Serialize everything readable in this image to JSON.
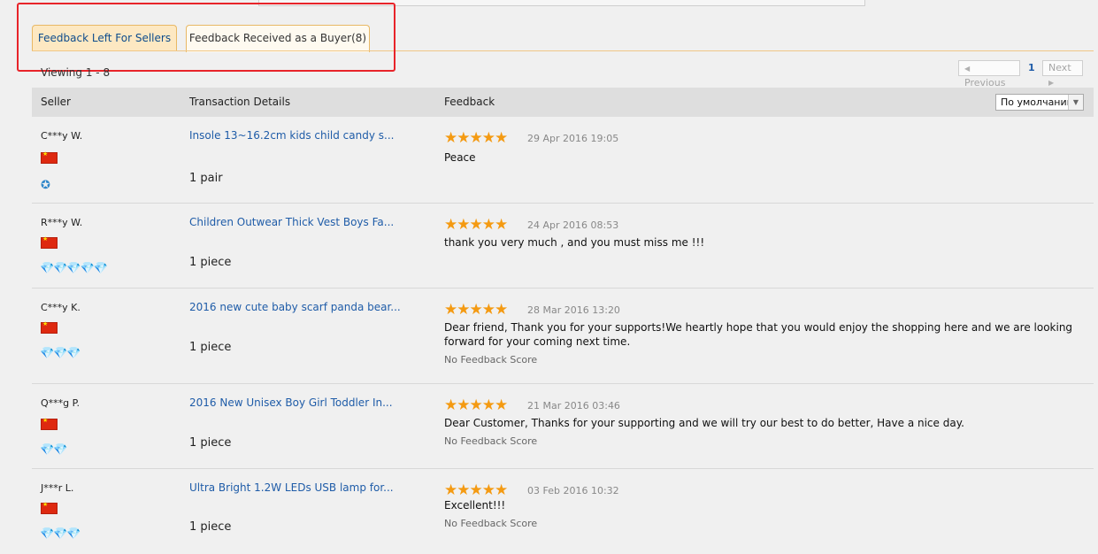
{
  "tabs": {
    "sellers": "Feedback Left For Sellers",
    "buyer": "Feedback Received as a Buyer(8)"
  },
  "viewing": "Viewing 1 - 8",
  "pager": {
    "prev": "Previous",
    "current": "1",
    "next": "Next"
  },
  "table": {
    "headers": {
      "seller": "Seller",
      "details": "Transaction Details",
      "feedback": "Feedback"
    },
    "sort_selected": "По умолчанию"
  },
  "icons": {
    "arrow_left": "◀",
    "arrow_right": "▶",
    "dropdown": "▼",
    "stars": "★★★★★",
    "medal": "✪",
    "d1": "💎",
    "d2": "💎💎",
    "d3": "💎💎💎",
    "d5": "💎💎💎💎💎"
  },
  "rows": [
    {
      "seller": "C***y W.",
      "product": "Insole 13~16.2cm kids child candy s...",
      "qty": "1 pair",
      "date": "29 Apr 2016 19:05",
      "text": "Peace",
      "score": ""
    },
    {
      "seller": "R***y W.",
      "product": "Children Outwear Thick Vest Boys Fa...",
      "qty": "1 piece",
      "date": "24 Apr 2016 08:53",
      "text": "thank you very much , and you must miss me !!!",
      "score": ""
    },
    {
      "seller": "C***y K.",
      "product": "2016 new cute baby scarf panda bear...",
      "qty": "1 piece",
      "date": "28 Mar 2016 13:20",
      "text": "Dear friend, Thank you for your supports!We heartly hope that you would enjoy the shopping here and we are looking forward for your coming next time.",
      "score": "No Feedback Score"
    },
    {
      "seller": "Q***g P.",
      "product": "2016 New Unisex Boy Girl Toddler In...",
      "qty": "1 piece",
      "date": "21 Mar 2016 03:46",
      "text": "Dear Customer, Thanks for your supporting and we will try our best to do better, Have a nice day.",
      "score": "No Feedback Score"
    },
    {
      "seller": "J***r L.",
      "product": "Ultra Bright 1.2W LEDs USB lamp for...",
      "qty": "1 piece",
      "date": "03 Feb 2016 10:32",
      "text": "Excellent!!!",
      "score": "No Feedback Score"
    }
  ]
}
